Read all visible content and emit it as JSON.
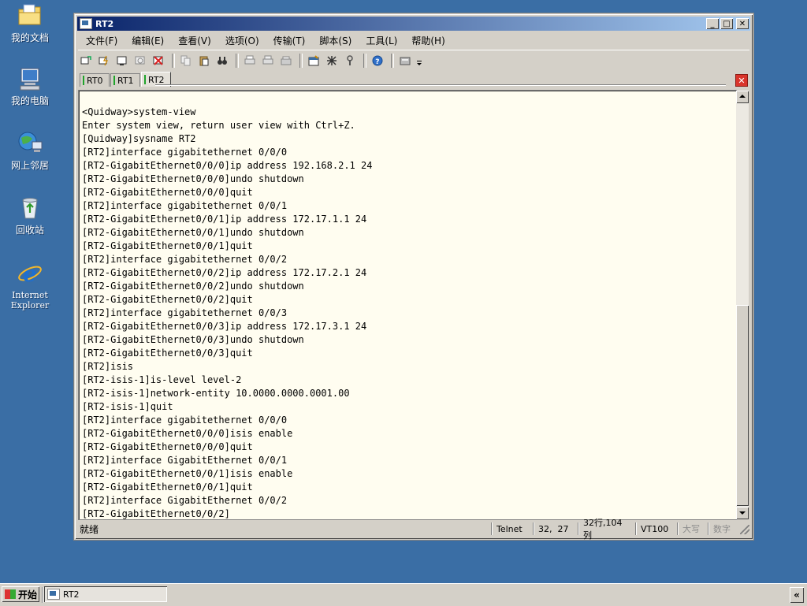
{
  "desktop": {
    "icons": [
      {
        "label": "我的文档",
        "icon": "folder-docs-icon"
      },
      {
        "label": "我的电脑",
        "icon": "computer-icon"
      },
      {
        "label": "网上邻居",
        "icon": "network-icon"
      },
      {
        "label": "回收站",
        "icon": "recycle-bin-icon"
      },
      {
        "label_line1": "Internet",
        "label_line2": "Explorer",
        "icon": "ie-icon"
      }
    ]
  },
  "window": {
    "title": "RT2",
    "buttons": {
      "minimize": "_",
      "maximize": "□",
      "close": "✕"
    },
    "menu": [
      "文件(F)",
      "编辑(E)",
      "查看(V)",
      "选项(O)",
      "传输(T)",
      "脚本(S)",
      "工具(L)",
      "帮助(H)"
    ],
    "tabs": [
      {
        "label": "RT0",
        "active": false
      },
      {
        "label": "RT1",
        "active": false
      },
      {
        "label": "RT2",
        "active": true
      }
    ],
    "tab_close": "✕",
    "terminal_lines": [
      "<Quidway>system-view",
      "Enter system view, return user view with Ctrl+Z.",
      "[Quidway]sysname RT2",
      "[RT2]interface gigabitethernet 0/0/0",
      "[RT2-GigabitEthernet0/0/0]ip address 192.168.2.1 24",
      "[RT2-GigabitEthernet0/0/0]undo shutdown",
      "[RT2-GigabitEthernet0/0/0]quit",
      "[RT2]interface gigabitethernet 0/0/1",
      "[RT2-GigabitEthernet0/0/1]ip address 172.17.1.1 24",
      "[RT2-GigabitEthernet0/0/1]undo shutdown",
      "[RT2-GigabitEthernet0/0/1]quit",
      "[RT2]interface gigabitethernet 0/0/2",
      "[RT2-GigabitEthernet0/0/2]ip address 172.17.2.1 24",
      "[RT2-GigabitEthernet0/0/2]undo shutdown",
      "[RT2-GigabitEthernet0/0/2]quit",
      "[RT2]interface gigabitethernet 0/0/3",
      "[RT2-GigabitEthernet0/0/3]ip address 172.17.3.1 24",
      "[RT2-GigabitEthernet0/0/3]undo shutdown",
      "[RT2-GigabitEthernet0/0/3]quit",
      "[RT2]isis",
      "[RT2-isis-1]is-level level-2",
      "[RT2-isis-1]network-entity 10.0000.0000.0001.00",
      "[RT2-isis-1]quit",
      "[RT2]interface gigabitethernet 0/0/0",
      "[RT2-GigabitEthernet0/0/0]isis enable",
      "[RT2-GigabitEthernet0/0/0]quit",
      "[RT2]interface GigabitEthernet 0/0/1",
      "[RT2-GigabitEthernet0/0/1]isis enable",
      "[RT2-GigabitEthernet0/0/1]quit",
      "[RT2]interface GigabitEthernet 0/0/2",
      "[RT2-GigabitEthernet0/0/2]"
    ],
    "status": {
      "ready": "就绪",
      "protocol": "Telnet",
      "cursor": "32,  27",
      "size": "32行,104列",
      "emulation": "VT100",
      "caps": "大写",
      "num": "数字"
    }
  },
  "taskbar": {
    "start_label": "开始",
    "task_title": "RT2",
    "tray_label": "«"
  },
  "colors": {
    "desktop": "#3a6ea5",
    "titlebar_start": "#0a246a",
    "titlebar_end": "#a6caf0",
    "terminal_bg": "#fffdf0",
    "tab_indicator": "#1fa32a",
    "tab_close": "#d9342b"
  }
}
